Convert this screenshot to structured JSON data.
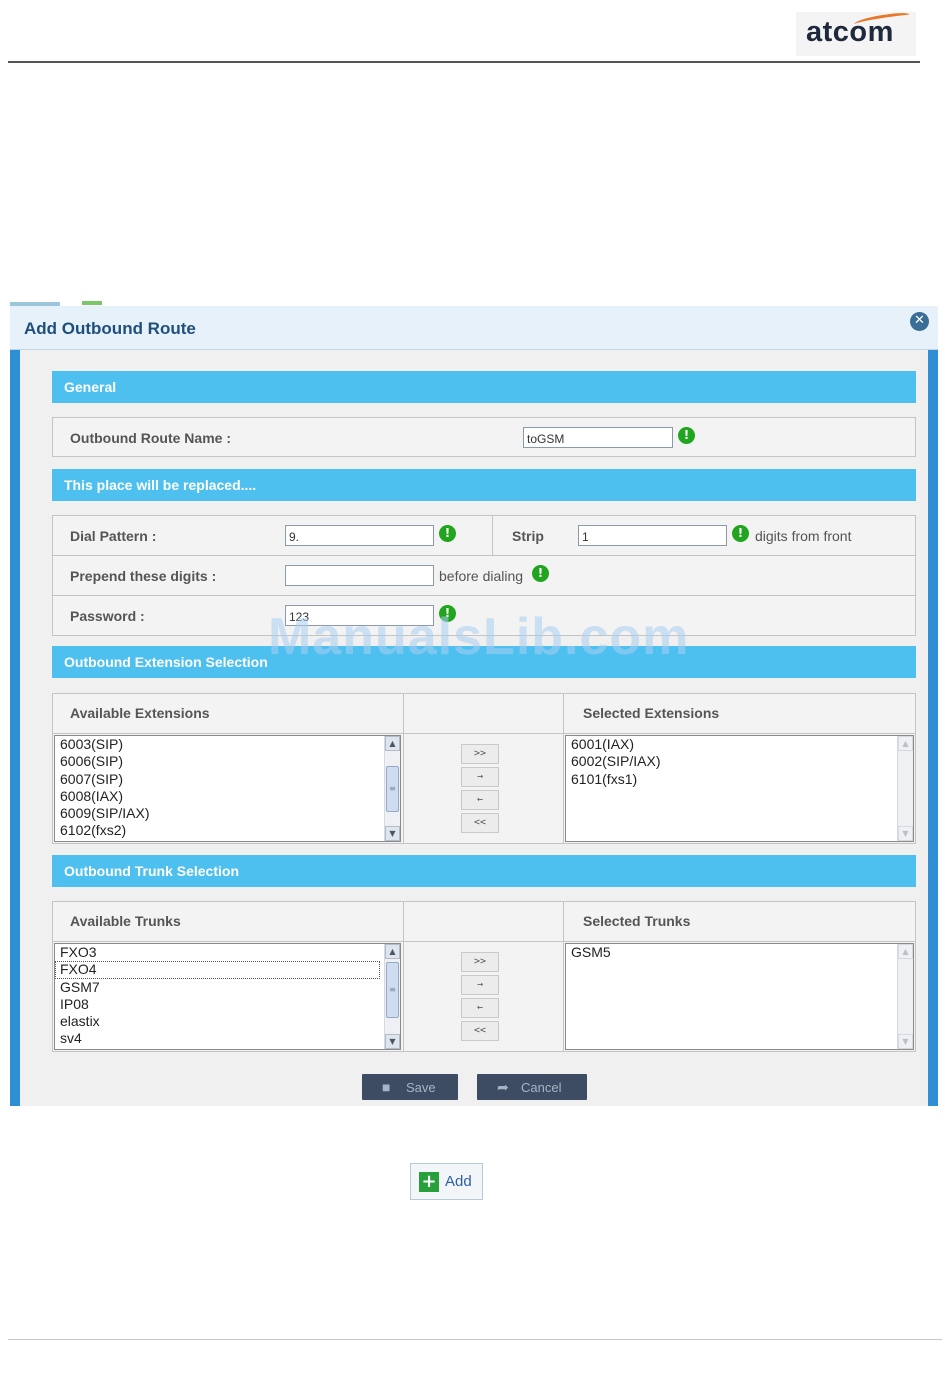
{
  "brand": {
    "logo_text": "atcom",
    "accent_color": "#e8772a"
  },
  "dialog": {
    "title": "Add Outbound Route",
    "close_icon": "close-icon",
    "general": {
      "header": "General",
      "route_name_label": "Outbound Route Name :",
      "route_name_value": "toGSM"
    },
    "placeholder_header": "This place will be replaced....",
    "dial": {
      "dial_pattern_label": "Dial Pattern :",
      "dial_pattern_value": "9.",
      "strip_label": "Strip",
      "strip_value": "1",
      "strip_suffix": "digits from front",
      "prepend_label": "Prepend these digits :",
      "prepend_value": "",
      "prepend_suffix": "before dialing",
      "password_label": "Password :",
      "password_value": "123"
    },
    "extensions": {
      "header": "Outbound Extension Selection",
      "available_label": "Available Extensions",
      "selected_label": "Selected Extensions",
      "available": [
        "6003(SIP)",
        "6006(SIP)",
        "6007(SIP)",
        "6008(IAX)",
        "6009(SIP/IAX)",
        "6102(fxs2)"
      ],
      "selected": [
        "6001(IAX)",
        "6002(SIP/IAX)",
        "6101(fxs1)"
      ]
    },
    "trunks": {
      "header": "Outbound Trunk Selection",
      "available_label": "Available Trunks",
      "selected_label": "Selected Trunks",
      "available": [
        "FXO3",
        "FXO4",
        "GSM7",
        "IP08",
        "elastix",
        "sv4"
      ],
      "selected": [
        "GSM5"
      ]
    },
    "move_buttons": {
      "add_all": ">>",
      "add_one": "→",
      "remove_one": "←",
      "remove_all": "<<"
    },
    "save_label": "Save",
    "cancel_label": "Cancel"
  },
  "watermark": "ManualsLib.com",
  "add_button_label": "Add",
  "colors": {
    "section_bar": "#4ec0ef",
    "dialog_frame": "#2f8fd4",
    "info_green": "#21a51f"
  }
}
